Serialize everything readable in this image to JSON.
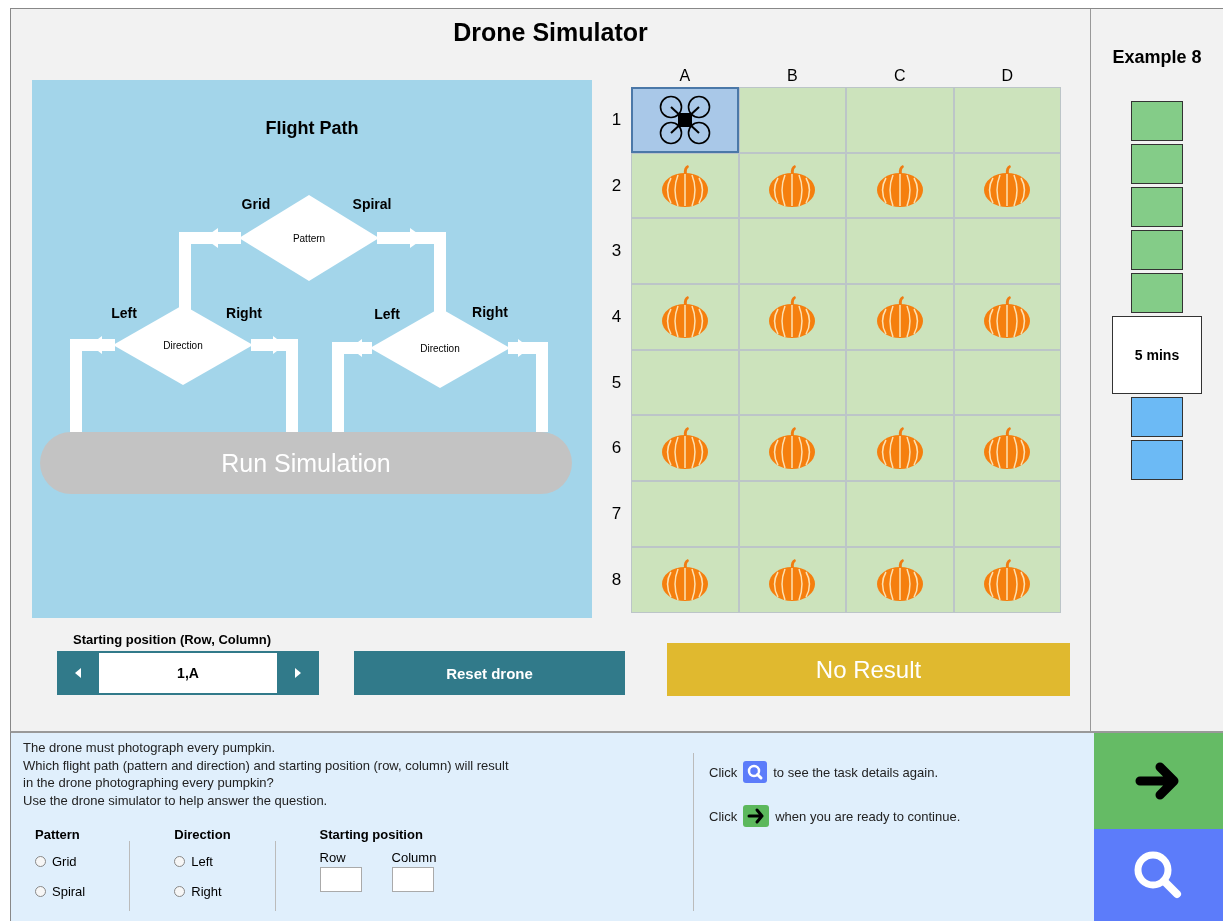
{
  "title": "Drone Simulator",
  "flight_path": {
    "title": "Flight Path",
    "pattern_label": "Pattern",
    "pattern_branches": [
      "Grid",
      "Spiral"
    ],
    "directions": [
      {
        "label": "Direction",
        "branches": [
          "Left",
          "Right"
        ]
      },
      {
        "label": "Direction",
        "branches": [
          "Left",
          "Right"
        ]
      }
    ],
    "run_button": "Run Simulation"
  },
  "grid": {
    "columns": [
      "A",
      "B",
      "C",
      "D"
    ],
    "rows": [
      {
        "label": "1",
        "cells": [
          {
            "kind": "drone",
            "selected": true
          },
          {
            "kind": "empty",
            "selected": false
          },
          {
            "kind": "empty",
            "selected": false
          },
          {
            "kind": "empty",
            "selected": false
          }
        ]
      },
      {
        "label": "2",
        "cells": [
          {
            "kind": "pumpkin",
            "selected": false
          },
          {
            "kind": "pumpkin",
            "selected": false
          },
          {
            "kind": "pumpkin",
            "selected": false
          },
          {
            "kind": "pumpkin",
            "selected": false
          }
        ]
      },
      {
        "label": "3",
        "cells": [
          {
            "kind": "empty",
            "selected": false
          },
          {
            "kind": "empty",
            "selected": false
          },
          {
            "kind": "empty",
            "selected": false
          },
          {
            "kind": "empty",
            "selected": false
          }
        ]
      },
      {
        "label": "4",
        "cells": [
          {
            "kind": "pumpkin",
            "selected": false
          },
          {
            "kind": "pumpkin",
            "selected": false
          },
          {
            "kind": "pumpkin",
            "selected": false
          },
          {
            "kind": "pumpkin",
            "selected": false
          }
        ]
      },
      {
        "label": "5",
        "cells": [
          {
            "kind": "empty",
            "selected": false
          },
          {
            "kind": "empty",
            "selected": false
          },
          {
            "kind": "empty",
            "selected": false
          },
          {
            "kind": "empty",
            "selected": false
          }
        ]
      },
      {
        "label": "6",
        "cells": [
          {
            "kind": "pumpkin",
            "selected": false
          },
          {
            "kind": "pumpkin",
            "selected": false
          },
          {
            "kind": "pumpkin",
            "selected": false
          },
          {
            "kind": "pumpkin",
            "selected": false
          }
        ]
      },
      {
        "label": "7",
        "cells": [
          {
            "kind": "empty",
            "selected": false
          },
          {
            "kind": "empty",
            "selected": false
          },
          {
            "kind": "empty",
            "selected": false
          },
          {
            "kind": "empty",
            "selected": false
          }
        ]
      },
      {
        "label": "8",
        "cells": [
          {
            "kind": "pumpkin",
            "selected": false
          },
          {
            "kind": "pumpkin",
            "selected": false
          },
          {
            "kind": "pumpkin",
            "selected": false
          },
          {
            "kind": "pumpkin",
            "selected": false
          }
        ]
      }
    ]
  },
  "start_position": {
    "label": "Starting position (Row, Column)",
    "value": "1,A"
  },
  "reset_button": "Reset drone",
  "result": "No Result",
  "example": "Example 8",
  "timer": [
    {
      "kind": "block",
      "color": "#84cc88"
    },
    {
      "kind": "block",
      "color": "#84cc88"
    },
    {
      "kind": "block",
      "color": "#84cc88"
    },
    {
      "kind": "block",
      "color": "#84cc88"
    },
    {
      "kind": "block",
      "color": "#84cc88"
    },
    {
      "kind": "label",
      "text": "5 mins"
    },
    {
      "kind": "block",
      "color": "#6cbaf5"
    },
    {
      "kind": "block",
      "color": "#6cbaf5"
    }
  ],
  "question_lines": [
    "The drone must photograph every pumpkin.",
    "Which flight path (pattern and direction) and starting position (row, column) will result",
    "in the drone photographing every pumpkin?",
    "Use the drone simulator to help answer the question."
  ],
  "answer": {
    "groups": [
      {
        "title": "Pattern",
        "options": [
          {
            "label": "Grid",
            "selected": false
          },
          {
            "label": "Spiral",
            "selected": false
          }
        ]
      },
      {
        "title": "Direction",
        "options": [
          {
            "label": "Left",
            "selected": false
          },
          {
            "label": "Right",
            "selected": false
          }
        ]
      }
    ],
    "start_title": "Starting position",
    "fields": [
      {
        "label": "Row"
      },
      {
        "label": "Column"
      }
    ]
  },
  "hints": [
    {
      "kind": "search",
      "before": "Click",
      "after": "to see the task details again."
    },
    {
      "kind": "next",
      "before": "Click",
      "after": "when you are ready to continue."
    }
  ]
}
